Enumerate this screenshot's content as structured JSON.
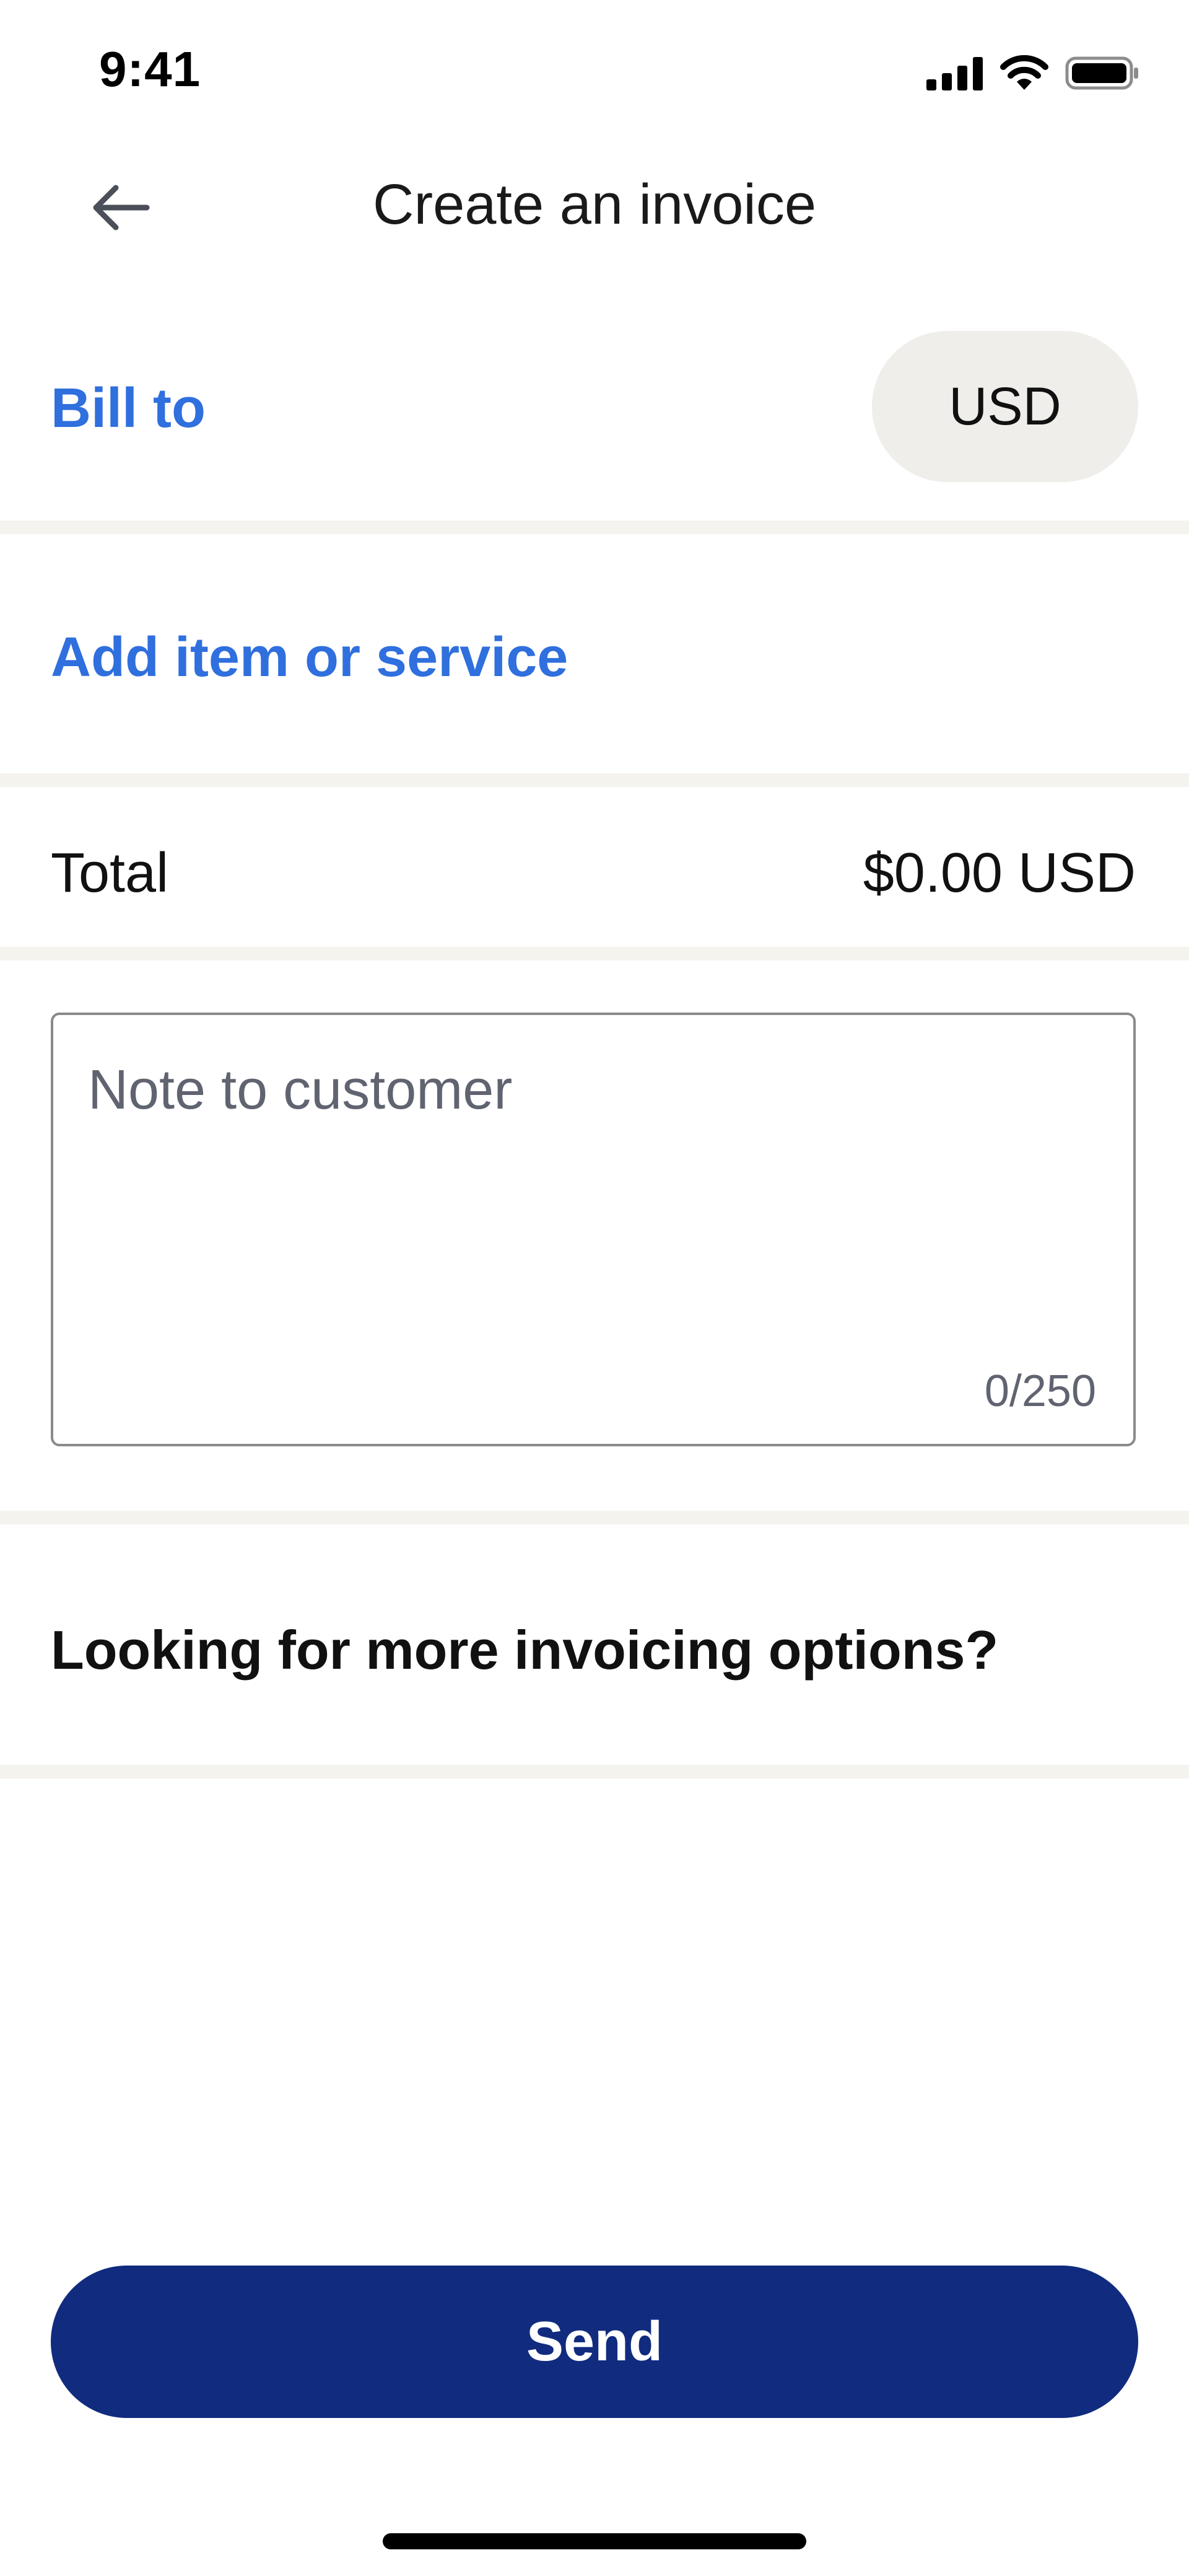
{
  "status_bar": {
    "time": "9:41",
    "icons": [
      "cellular-signal-icon",
      "wifi-icon",
      "battery-icon"
    ]
  },
  "header": {
    "title": "Create an invoice",
    "back_icon": "arrow-left-icon"
  },
  "bill_to": {
    "label": "Bill to",
    "currency": "USD"
  },
  "items": {
    "add_label": "Add item or service"
  },
  "total": {
    "label": "Total",
    "value": "$0.00 USD"
  },
  "note": {
    "placeholder": "Note to customer",
    "value": "",
    "char_count": "0/250"
  },
  "more_options": {
    "label": "Looking for more invoicing options?"
  },
  "footer": {
    "send_label": "Send"
  },
  "colors": {
    "link_blue": "#2f6fde",
    "primary_navy": "#112b7f",
    "pill_bg": "#efeeea",
    "divider": "#f5f3ee"
  }
}
